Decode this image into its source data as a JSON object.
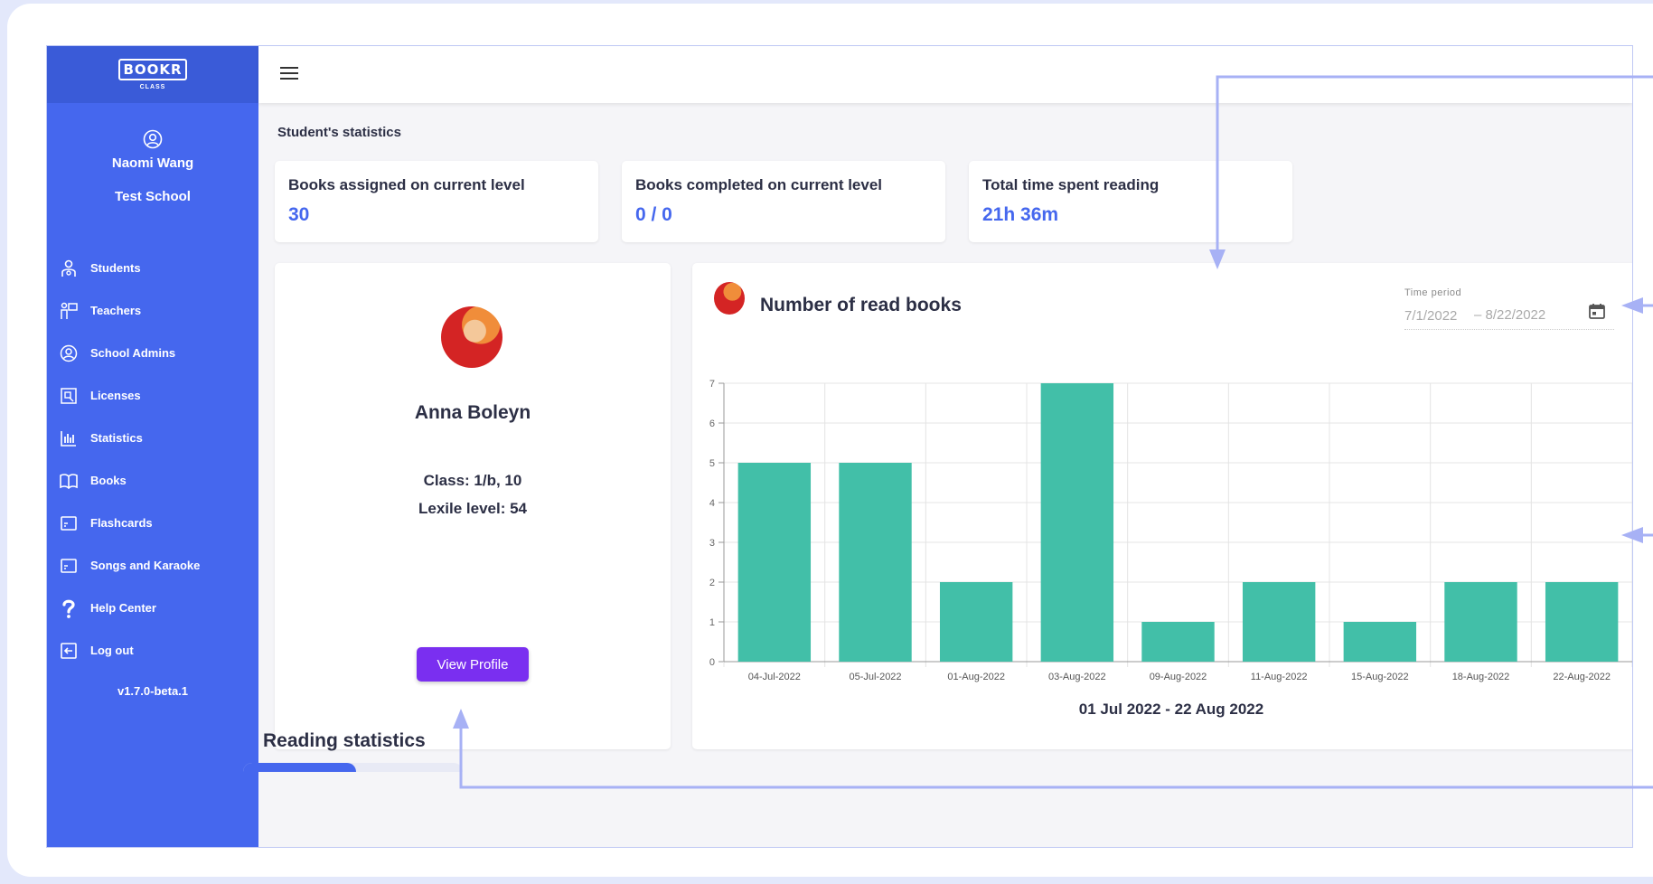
{
  "brand": {
    "logo": "BOOKR",
    "logo_sub": "CLASS",
    "accent": "#4567ee",
    "sidebar_bg": "#4567ee",
    "button_color": "#7a2ff0",
    "bar_color": "#42bfa8",
    "annotation_color": "#a7b1f5"
  },
  "sidebar": {
    "user_name": "Naomi Wang",
    "school": "Test School",
    "items": [
      {
        "label": "Students",
        "icon": "students-icon"
      },
      {
        "label": "Teachers",
        "icon": "teachers-icon"
      },
      {
        "label": "School Admins",
        "icon": "admin-icon"
      },
      {
        "label": "Licenses",
        "icon": "license-icon"
      },
      {
        "label": "Statistics",
        "icon": "statistics-icon"
      },
      {
        "label": "Books",
        "icon": "book-icon"
      },
      {
        "label": "Flashcards",
        "icon": "flashcard-icon"
      },
      {
        "label": "Songs and Karaoke",
        "icon": "songs-icon"
      },
      {
        "label": "Help Center",
        "icon": "help-icon"
      },
      {
        "label": "Log out",
        "icon": "logout-icon"
      }
    ],
    "version": "v1.7.0-beta.1"
  },
  "page": {
    "title": "Student's statistics"
  },
  "stats": [
    {
      "label": "Books assigned on current level",
      "value": "30"
    },
    {
      "label": "Books completed on current level",
      "value": "0 / 0"
    },
    {
      "label": "Total time spent reading",
      "value": "21h 36m"
    }
  ],
  "profile": {
    "name": "Anna Boleyn",
    "class_line": "Class: 1/b, 10",
    "lexile_line": "Lexile level: 54",
    "button": "View Profile"
  },
  "chart": {
    "title": "Number of read books",
    "time_period_label": "Time period",
    "start_date": "7/1/2022",
    "end_date": "– 8/22/2022",
    "range_label": "01 Jul 2022 - 22 Aug 2022"
  },
  "chart_data": {
    "type": "bar",
    "title": "Number of read books",
    "categories": [
      "04-Jul-2022",
      "05-Jul-2022",
      "01-Aug-2022",
      "03-Aug-2022",
      "09-Aug-2022",
      "11-Aug-2022",
      "15-Aug-2022",
      "18-Aug-2022",
      "22-Aug-2022"
    ],
    "values": [
      5,
      5,
      2,
      7,
      1,
      2,
      1,
      2,
      2
    ],
    "xlabel": "01 Jul 2022 - 22 Aug 2022",
    "ylabel": "",
    "ylim": [
      0,
      7
    ],
    "yticks": [
      0,
      1,
      2,
      3,
      4,
      5,
      6,
      7
    ],
    "grid": true
  },
  "reading": {
    "title": "Reading statistics"
  }
}
